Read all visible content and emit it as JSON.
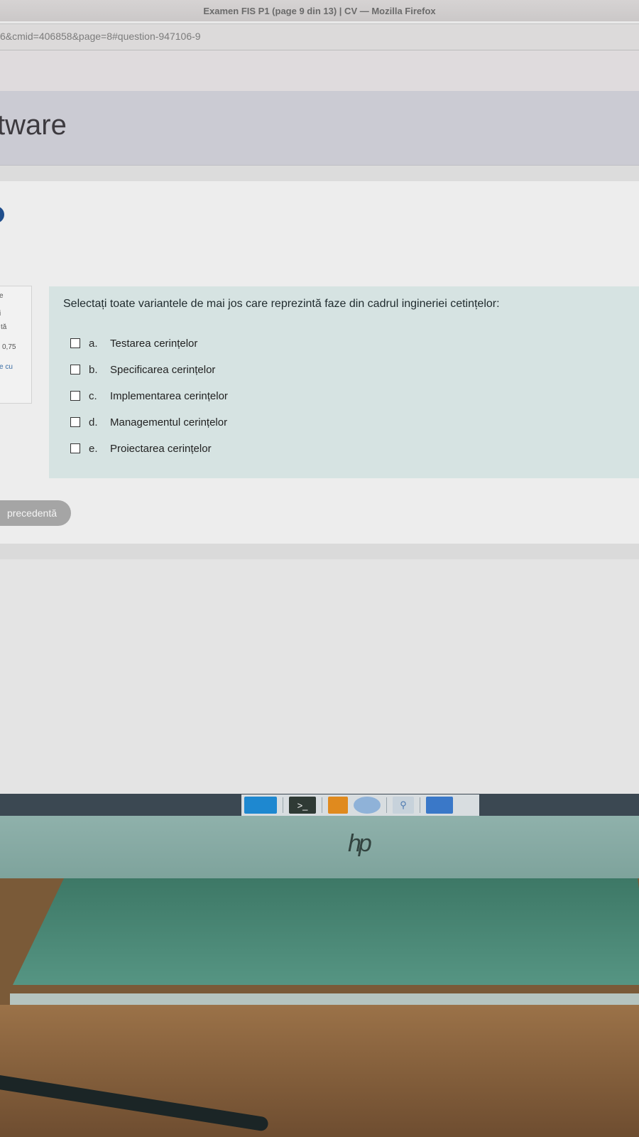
{
  "window": {
    "title": "Examen FIS P1 (page 9 din 13) | CV — Mozilla Firefox"
  },
  "browser": {
    "url": "6&cmid=406858&page=8#question-947106-9"
  },
  "page": {
    "heading": "tware"
  },
  "info_panel": {
    "lines": [
      "e",
      "i",
      "tă",
      "0,75",
      "e cu"
    ]
  },
  "question": {
    "text": "Selectați toate variantele de mai jos care reprezintă faze din cadrul ingineriei cetințelor:",
    "answers": [
      {
        "letter": "a.",
        "text": "Testarea cerințelor",
        "checked": false
      },
      {
        "letter": "b.",
        "text": "Specificarea cerințelor",
        "checked": false
      },
      {
        "letter": "c.",
        "text": "Implementarea cerințelor",
        "checked": false
      },
      {
        "letter": "d.",
        "text": "Managementul cerințelor",
        "checked": false
      },
      {
        "letter": "e.",
        "text": "Proiectarea cerințelor",
        "checked": false
      }
    ]
  },
  "navigation": {
    "prev_label": "precedentă"
  },
  "taskbar": {
    "terminal_glyph": ">_"
  },
  "monitor": {
    "logo": "hp"
  },
  "colors": {
    "question_bg": "#d6e3e2",
    "button_bg": "#a5a5a5",
    "taskbar": "#3b4852"
  }
}
